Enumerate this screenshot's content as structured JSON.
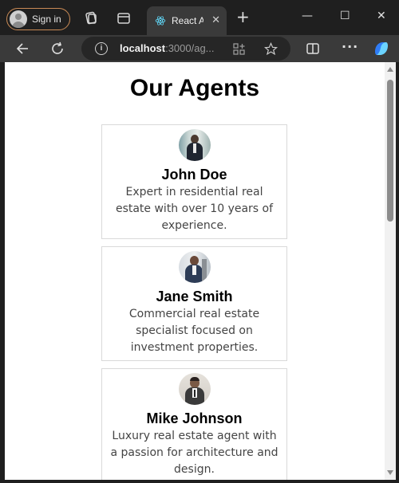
{
  "browser": {
    "sign_in_label": "Sign in",
    "tab_title": "React A",
    "url_host": "localhost",
    "url_path": ":3000/ag..."
  },
  "page": {
    "title": "Our Agents",
    "agents": [
      {
        "name": "John Doe",
        "description": "Expert in residential real estate with over 10 years of experience."
      },
      {
        "name": "Jane Smith",
        "description": "Commercial real estate specialist focused on investment properties."
      },
      {
        "name": "Mike Johnson",
        "description": "Luxury real estate agent with a passion for architecture and design."
      }
    ]
  },
  "colors": {
    "chrome_dark": "#1f1f1f",
    "toolbar": "#3a3a3a",
    "sign_in_border": "#c98a55",
    "react_blue": "#61dafb"
  }
}
